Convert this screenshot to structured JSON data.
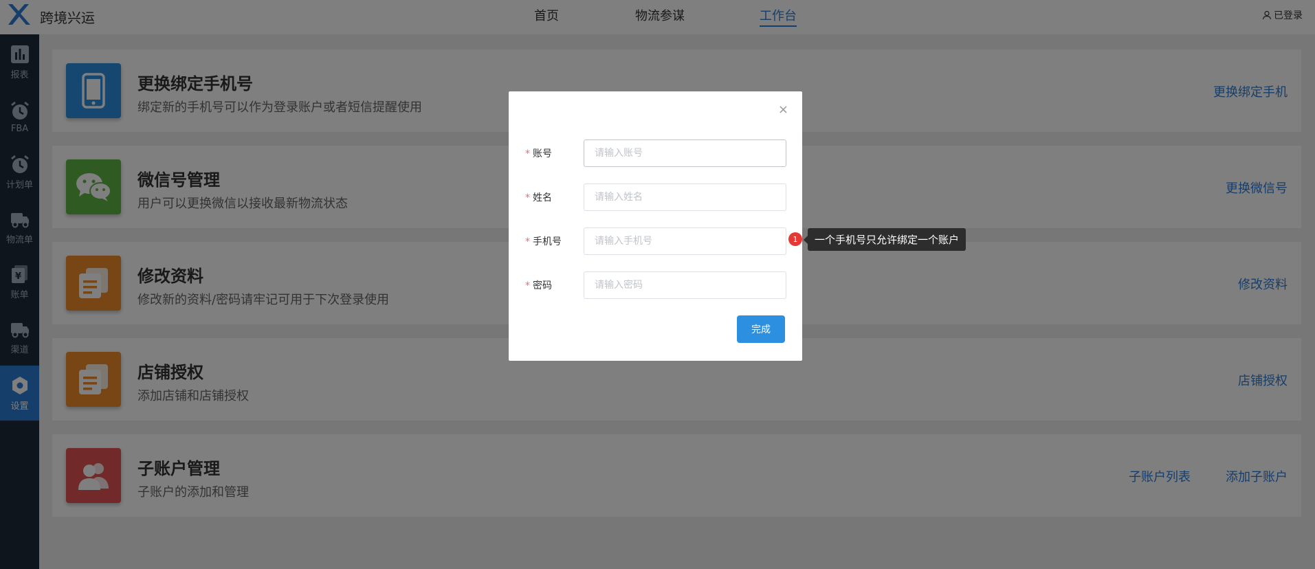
{
  "header": {
    "brand": "跨境兴运",
    "nav": [
      "首页",
      "物流参谋",
      "工作台"
    ],
    "active_nav": "工作台",
    "user_label": "已登录"
  },
  "sidebar": {
    "items": [
      {
        "label": "报表",
        "icon": "chart-bar-icon"
      },
      {
        "label": "FBA",
        "icon": "alarm-clock-icon"
      },
      {
        "label": "计划单",
        "icon": "alarm-clock-icon"
      },
      {
        "label": "物流单",
        "icon": "truck-icon"
      },
      {
        "label": "账单",
        "icon": "bill-icon"
      },
      {
        "label": "渠道",
        "icon": "truck-icon"
      },
      {
        "label": "设置",
        "icon": "settings-hexagon-icon",
        "active": true
      }
    ]
  },
  "cards": [
    {
      "title": "更换绑定手机号",
      "desc": "绑定新的手机号可以作为登录账户或者短信提醒使用",
      "actions": [
        "更换绑定手机"
      ],
      "color": "#2d8fe0",
      "icon": "phone-icon"
    },
    {
      "title": "微信号管理",
      "desc": "用户可以更换微信以接收最新物流状态",
      "actions": [
        "更换微信号"
      ],
      "color": "#5fb646",
      "icon": "wechat-icon"
    },
    {
      "title": "修改资料",
      "desc": "修改新的资料/密码请牢记可用于下次登录使用",
      "actions": [
        "修改资料"
      ],
      "color": "#f08a2b",
      "icon": "document-icon"
    },
    {
      "title": "店铺授权",
      "desc": "添加店铺和店铺授权",
      "actions": [
        "店铺授权"
      ],
      "color": "#f08a2b",
      "icon": "document-icon"
    },
    {
      "title": "子账户管理",
      "desc": "子账户的添加和管理",
      "actions": [
        "子账户列表",
        "添加子账户"
      ],
      "color": "#e45252",
      "icon": "users-icon"
    }
  ],
  "modal": {
    "fields": [
      {
        "label": "账号",
        "placeholder": "请输入账号",
        "required": true
      },
      {
        "label": "姓名",
        "placeholder": "请输入姓名",
        "required": true
      },
      {
        "label": "手机号",
        "placeholder": "请输入手机号",
        "required": true
      },
      {
        "label": "密码",
        "placeholder": "请输入密码",
        "required": true
      }
    ],
    "submit_label": "完成",
    "close_symbol": "×"
  },
  "tooltip": {
    "badge": "1",
    "text": "一个手机号只允许绑定一个账户"
  },
  "colors": {
    "primary": "#2d7cd6",
    "sidebar_bg": "#1c2b3a",
    "required": "#f56c6c"
  }
}
